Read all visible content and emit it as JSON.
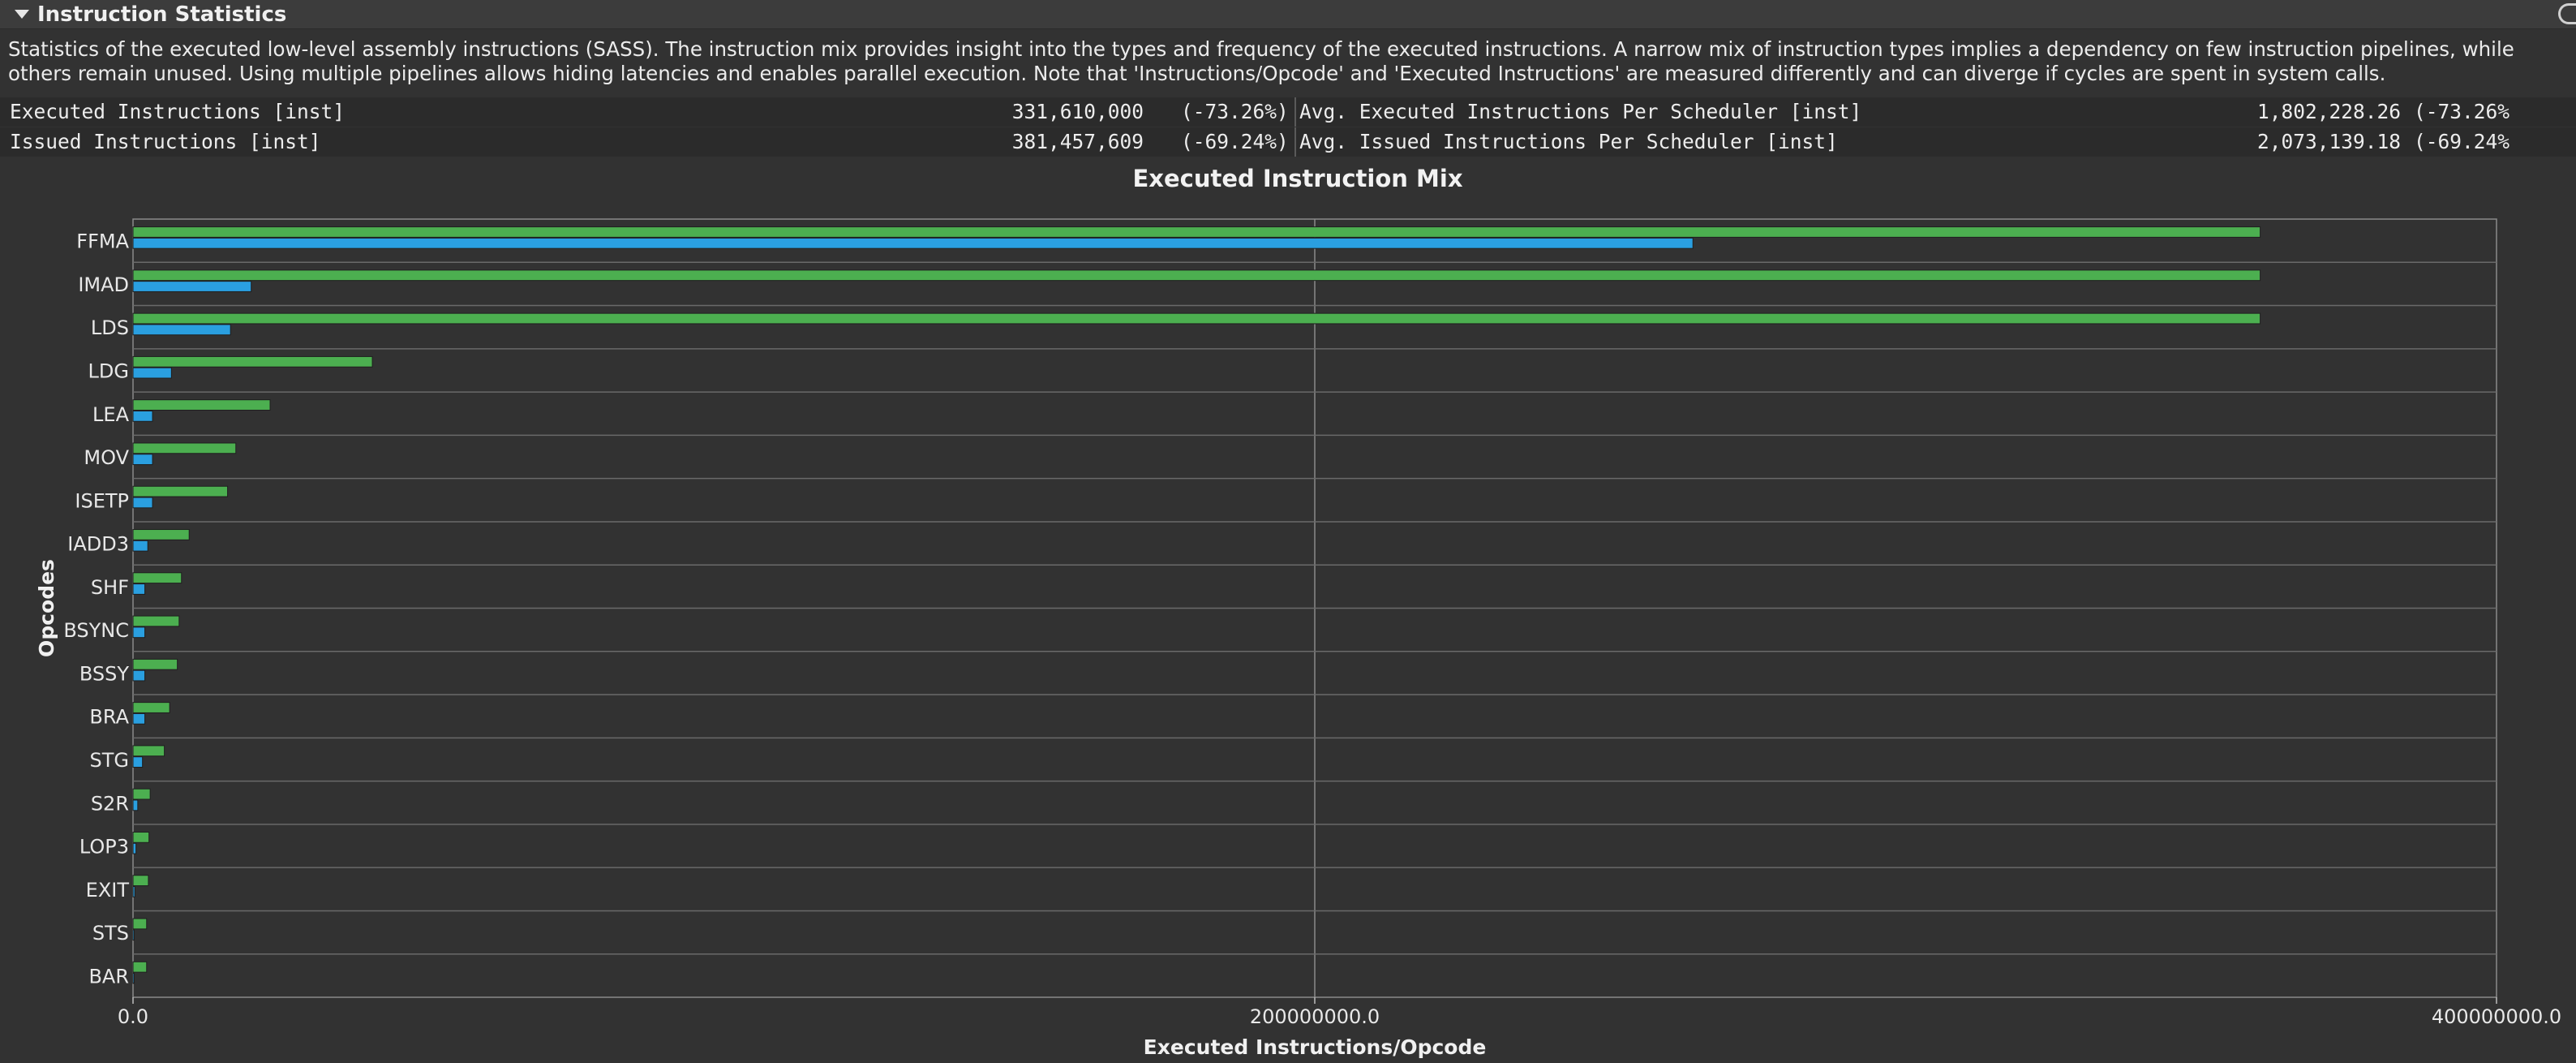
{
  "section": {
    "title": "Instruction Statistics"
  },
  "description": "Statistics of the executed low-level assembly instructions (SASS). The instruction mix provides insight into the types and frequency of the executed instructions. A narrow mix of instruction types implies a dependency on few instruction pipelines, while others remain unused. Using multiple pipelines allows hiding latencies and enables parallel execution. Note that 'Instructions/Opcode' and 'Executed Instructions' are measured differently and can diverge if cycles are spent in system calls.",
  "metrics": [
    {
      "left_name": "Executed Instructions [inst]",
      "left_value": "331,610,000",
      "left_delta": "(-73.26%)",
      "right_name": "Avg. Executed Instructions Per Scheduler [inst]",
      "right_value": "1,802,228.26",
      "right_delta": "(-73.26%"
    },
    {
      "left_name": "Issued Instructions [inst]",
      "left_value": "381,457,609",
      "left_delta": "(-69.24%)",
      "right_name": "Avg. Issued Instructions Per Scheduler [inst]",
      "right_value": "2,073,139.18",
      "right_delta": "(-69.24%"
    }
  ],
  "colors": {
    "baseline_bar": "#4caf50",
    "current_bar": "#2a9fe0",
    "plot_background": "#323232",
    "row_line": "#6a6a6a"
  },
  "chart_data": {
    "type": "bar",
    "orientation": "horizontal",
    "title": "Executed Instruction Mix",
    "xlabel": "Executed Instructions/Opcode",
    "ylabel": "Opcodes",
    "xlim": [
      0,
      400000000
    ],
    "xticks": [
      "0.0",
      "200000000.0",
      "400000000.0"
    ],
    "grid": true,
    "categories": [
      "FFMA",
      "IMAD",
      "LDS",
      "LDG",
      "LEA",
      "MOV",
      "ISETP",
      "IADD3",
      "SHF",
      "BSYNC",
      "BSSY",
      "BRA",
      "STG",
      "S2R",
      "LOP3",
      "EXIT",
      "STS",
      "BAR"
    ],
    "series": [
      {
        "values": [
          360000000,
          360000000,
          360000000,
          40500000,
          23200000,
          17400000,
          16000000,
          9500000,
          8200000,
          7800000,
          7500000,
          6200000,
          5300000,
          2900000,
          2700000,
          2600000,
          2300000,
          2300000
        ]
      },
      {
        "values": [
          264000000,
          20000000,
          16500000,
          6500000,
          3300000,
          3300000,
          3300000,
          2500000,
          2000000,
          2000000,
          2000000,
          2000000,
          1600000,
          800000,
          500000,
          300000,
          200000,
          200000
        ]
      }
    ]
  }
}
